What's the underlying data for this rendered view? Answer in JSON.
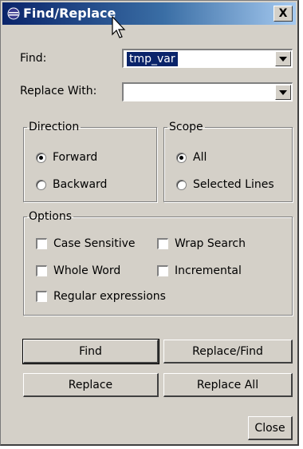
{
  "window": {
    "title": "Find/Replace",
    "close_label": "X"
  },
  "find": {
    "label": "Find:",
    "value": "tmp_var"
  },
  "replace_with": {
    "label": "Replace With:",
    "value": ""
  },
  "direction": {
    "label": "Direction",
    "options": [
      "Forward",
      "Backward"
    ],
    "selected": "Forward"
  },
  "scope": {
    "label": "Scope",
    "options": [
      "All",
      "Selected Lines"
    ],
    "selected": "All"
  },
  "options": {
    "label": "Options",
    "items": [
      {
        "label": "Case Sensitive",
        "checked": false
      },
      {
        "label": "Wrap Search",
        "checked": false
      },
      {
        "label": "Whole Word",
        "checked": false
      },
      {
        "label": "Incremental",
        "checked": false
      },
      {
        "label": "Regular expressions",
        "checked": false
      }
    ]
  },
  "buttons": {
    "find": "Find",
    "replace_find": "Replace/Find",
    "replace": "Replace",
    "replace_all": "Replace All",
    "close": "Close"
  },
  "colors": {
    "titlebar_start": "#0a246a",
    "titlebar_end": "#a6caf0",
    "dialog_bg": "#d4d0c8",
    "selection": "#0a246a"
  }
}
